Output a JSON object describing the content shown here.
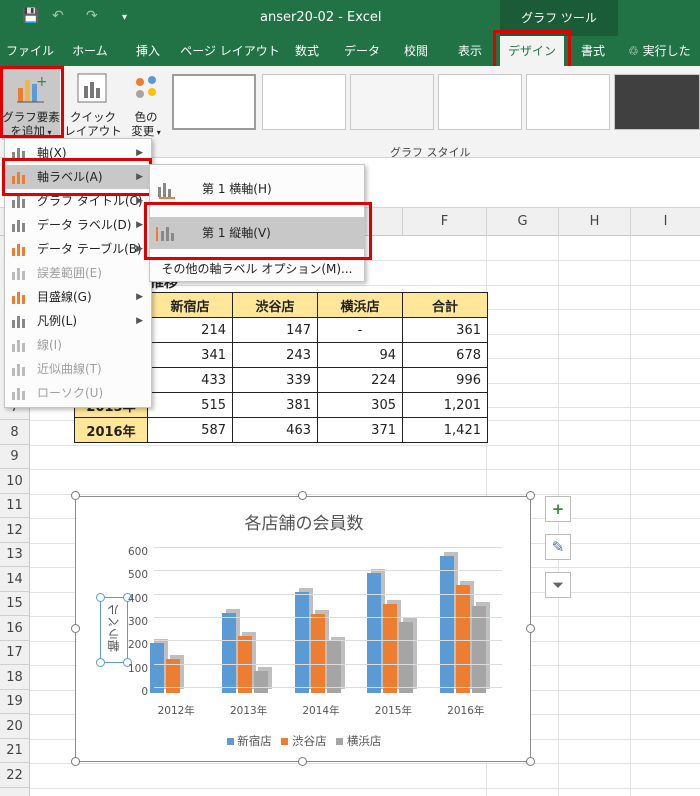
{
  "window": {
    "title": "anser20-02  -  Excel",
    "context_tab": "グラフ ツール"
  },
  "tabs": [
    "ファイル",
    "ホーム",
    "挿入",
    "ページ レイアウト",
    "数式",
    "データ",
    "校閲",
    "表示",
    "デザイン",
    "書式"
  ],
  "tell_me": "実行したい",
  "ribbon": {
    "add_element_l1": "グラフ要素",
    "add_element_l2": "を追加",
    "quick_layout_l1": "クイック",
    "quick_layout_l2": "レイアウト",
    "color_l1": "色の",
    "color_l2": "変更",
    "group_label": "グラフ スタイル"
  },
  "menu1": [
    {
      "label": "軸(X)",
      "disabled": false
    },
    {
      "label": "軸ラベル(A)",
      "disabled": false
    },
    {
      "label": "グラフ タイトル(C)",
      "disabled": false
    },
    {
      "label": "データ ラベル(D)",
      "disabled": false
    },
    {
      "label": "データ テーブル(B)",
      "disabled": false
    },
    {
      "label": "誤差範囲(E)",
      "disabled": true
    },
    {
      "label": "目盛線(G)",
      "disabled": false
    },
    {
      "label": "凡例(L)",
      "disabled": false
    },
    {
      "label": "線(I)",
      "disabled": true
    },
    {
      "label": "近似曲線(T)",
      "disabled": true
    },
    {
      "label": "ローソク(U)",
      "disabled": true
    }
  ],
  "menu2": {
    "item1": "第 1 横軸(H)",
    "item2": "第 1 縦軸(V)",
    "more": "その他の軸ラベル オプション(M)..."
  },
  "columns": [
    "F",
    "G",
    "H",
    "I"
  ],
  "rows": [
    "7",
    "8",
    "9",
    "10",
    "11",
    "12",
    "13",
    "14",
    "15",
    "16",
    "17",
    "18",
    "19",
    "20",
    "21",
    "22"
  ],
  "table": {
    "partial_title": "推移",
    "headers": [
      "新宿店",
      "渋谷店",
      "横浜店",
      "合計"
    ],
    "rows": [
      {
        "year": "",
        "vals": [
          "214",
          "147",
          "-",
          "361"
        ]
      },
      {
        "year": "",
        "vals": [
          "341",
          "243",
          "94",
          "678"
        ]
      },
      {
        "year": "",
        "vals": [
          "433",
          "339",
          "224",
          "996"
        ]
      },
      {
        "year": "2015年",
        "vals": [
          "515",
          "381",
          "305",
          "1,201"
        ]
      },
      {
        "year": "2016年",
        "vals": [
          "587",
          "463",
          "371",
          "1,421"
        ]
      }
    ]
  },
  "chart": {
    "title": "各店舗の会員数",
    "axis_label": "軸ラベル",
    "yticks": [
      "600",
      "500",
      "400",
      "300",
      "200",
      "100",
      "0"
    ],
    "categories": [
      "2012年",
      "2013年",
      "2014年",
      "2015年",
      "2016年"
    ],
    "ymax": 600,
    "series": [
      {
        "name": "新宿店",
        "color": "#5b9bd5",
        "values": [
          214,
          341,
          433,
          515,
          587
        ]
      },
      {
        "name": "渋谷店",
        "color": "#ed7d31",
        "values": [
          147,
          243,
          339,
          381,
          463
        ]
      },
      {
        "name": "横浜店",
        "color": "#a5a5a5",
        "values": [
          0,
          94,
          224,
          305,
          371
        ]
      }
    ]
  }
}
